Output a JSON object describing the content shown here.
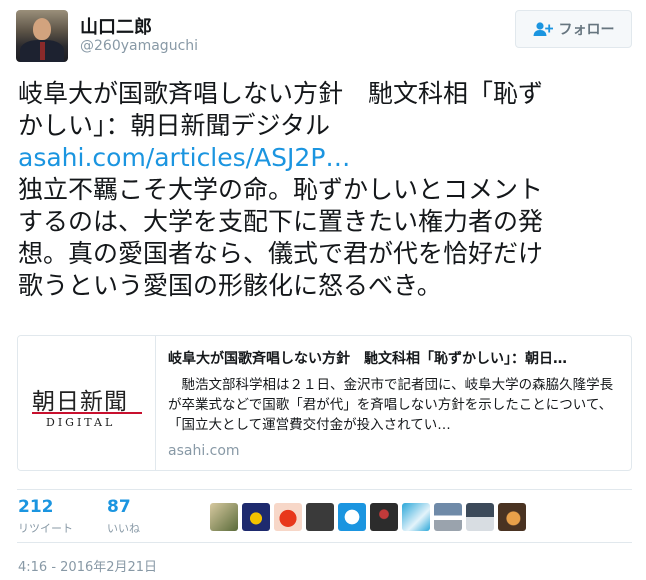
{
  "profile": {
    "name": "山口二郎",
    "handle": "@260yamaguchi",
    "follow_label": "フォロー"
  },
  "tweet": {
    "line1": "岐阜大が国歌斉唱しない方針　馳文科相「恥ず",
    "line2": "かしい」：朝日新聞デジタル",
    "link": "asahi.com/articles/ASJ2P…",
    "line4": "独立不羈こそ大学の命。恥ずかしいとコメント",
    "line5": "するのは、大学を支配下に置きたい権力者の発",
    "line6": "想。真の愛国者なら、儀式で君が代を恰好だけ",
    "line7": "歌うという愛国の形骸化に怒るべき。"
  },
  "card": {
    "logo_main": "朝日新聞",
    "logo_sub": "DIGITAL",
    "title": "岐阜大が国歌斉唱しない方針　馳文科相「恥ずかしい」：朝日…",
    "description": "　馳浩文部科学相は２１日、金沢市で記者団に、岐阜大学の森脇久隆学長が卒業式などで国歌「君が代」を斉唱しない方針を示したことについて、「国立大として運営費交付金が投入されてい…",
    "domain": "asahi.com"
  },
  "stats": {
    "retweets": "212",
    "retweets_label": "リツイート",
    "likes": "87",
    "likes_label": "いいね"
  },
  "timestamp": "4:16 - 2016年2月21日",
  "colors": {
    "link": "#1b95e0",
    "muted": "#8899a6",
    "border": "#e1e8ed"
  }
}
